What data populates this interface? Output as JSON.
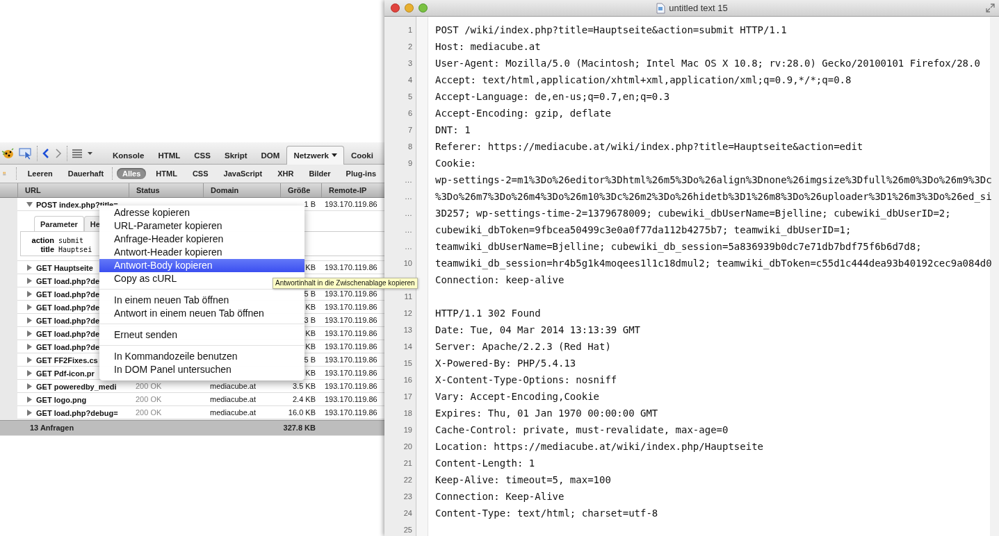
{
  "firebug": {
    "panel_tabs": [
      {
        "label": "Konsole",
        "selected": false
      },
      {
        "label": "HTML",
        "selected": false
      },
      {
        "label": "CSS",
        "selected": false
      },
      {
        "label": "Skript",
        "selected": false
      },
      {
        "label": "DOM",
        "selected": false
      },
      {
        "label": "Netzwerk",
        "selected": true,
        "dropdown": true
      },
      {
        "label": "Cooki",
        "selected": false
      }
    ],
    "actions": [
      "Leeren",
      "Dauerhaft"
    ],
    "filters": [
      {
        "label": "Alles",
        "selected": true
      },
      {
        "label": "HTML",
        "selected": false
      },
      {
        "label": "CSS",
        "selected": false
      },
      {
        "label": "JavaScript",
        "selected": false
      },
      {
        "label": "XHR",
        "selected": false
      },
      {
        "label": "Bilder",
        "selected": false
      },
      {
        "label": "Plug-ins",
        "selected": false
      }
    ],
    "columns": [
      "URL",
      "Status",
      "Domain",
      "Größe",
      "Remote-IP"
    ],
    "requests": [
      {
        "url": "POST index.php?title=",
        "size": "1 B",
        "ip": "193.170.119.86",
        "expanded": true,
        "detail": {
          "tabs": [
            {
              "label": "Parameter",
              "selected": true
            },
            {
              "label": "He",
              "selected": false
            }
          ],
          "params": [
            {
              "name": "action",
              "value": "submit"
            },
            {
              "name": "title",
              "value": "Hauptsei"
            }
          ]
        }
      },
      {
        "url": "GET Hauptseite",
        "size": "KB",
        "ip": "193.170.119.86",
        "expanded": false
      },
      {
        "url": "GET load.php?de",
        "expanded": false
      },
      {
        "url": "GET load.php?de",
        "size": "5 B",
        "ip": "193.170.119.86",
        "expanded": false
      },
      {
        "url": "GET load.php?de",
        "size": "KB",
        "ip": "193.170.119.86",
        "expanded": false
      },
      {
        "url": "GET load.php?de",
        "size": "3 B",
        "ip": "193.170.119.86",
        "expanded": false
      },
      {
        "url": "GET load.php?de",
        "size": "KB",
        "ip": "193.170.119.86",
        "expanded": false
      },
      {
        "url": "GET load.php?de",
        "size": "KB",
        "ip": "193.170.119.86",
        "expanded": false
      },
      {
        "url": "GET FF2Fixes.cs",
        "size": "5 B",
        "ip": "193.170.119.86",
        "expanded": false
      },
      {
        "url": "GET Pdf-icon.pr",
        "size": "KB",
        "ip": "193.170.119.86",
        "expanded": false
      },
      {
        "url": "GET poweredby_medi",
        "status": "200 OK",
        "domain": "mediacube.at",
        "size": "3.5 KB",
        "ip": "193.170.119.86",
        "expanded": false
      },
      {
        "url": "GET logo.png",
        "status": "200 OK",
        "domain": "mediacube.at",
        "size": "2.4 KB",
        "ip": "193.170.119.86",
        "expanded": false
      },
      {
        "url": "GET load.php?debug=",
        "status": "200 OK",
        "domain": "mediacube.at",
        "size": "16.0 KB",
        "ip": "193.170.119.86",
        "expanded": false
      }
    ],
    "footer": {
      "count": "13 Anfragen",
      "total": "327.8 KB"
    }
  },
  "context_menu": [
    [
      {
        "label": "Adresse kopieren",
        "selected": false
      },
      {
        "label": "URL-Parameter kopieren",
        "selected": false
      },
      {
        "label": "Anfrage-Header kopieren",
        "selected": false
      },
      {
        "label": "Antwort-Header kopieren",
        "selected": false
      },
      {
        "label": "Antwort-Body kopieren",
        "selected": true
      },
      {
        "label": "Copy as cURL",
        "selected": false
      }
    ],
    [
      {
        "label": "In einem neuen Tab öffnen",
        "selected": false
      },
      {
        "label": "Antwort in einem neuen Tab öffnen",
        "selected": false
      }
    ],
    [
      {
        "label": "Erneut senden",
        "selected": false
      }
    ],
    [
      {
        "label": "In Kommandozeile benutzen",
        "selected": false
      },
      {
        "label": "In DOM Panel untersuchen",
        "selected": false
      }
    ]
  ],
  "tooltip": "Antwortinhalt in die Zwischenablage kopieren",
  "editor": {
    "title": "untitled text 15",
    "lines": [
      {
        "gutter": "1",
        "text": "POST /wiki/index.php?title=Hauptseite&action=submit HTTP/1.1"
      },
      {
        "gutter": "2",
        "text": "Host: mediacube.at"
      },
      {
        "gutter": "3",
        "text": "User-Agent: Mozilla/5.0 (Macintosh; Intel Mac OS X 10.8; rv:28.0) Gecko/20100101 Firefox/28.0"
      },
      {
        "gutter": "4",
        "text": "Accept: text/html,application/xhtml+xml,application/xml;q=0.9,*/*;q=0.8"
      },
      {
        "gutter": "5",
        "text": "Accept-Language: de,en-us;q=0.7,en;q=0.3"
      },
      {
        "gutter": "6",
        "text": "Accept-Encoding: gzip, deflate"
      },
      {
        "gutter": "7",
        "text": "DNT: 1"
      },
      {
        "gutter": "8",
        "text": "Referer: https://mediacube.at/wiki/index.php?title=Hauptseite&action=edit"
      },
      {
        "gutter": "9",
        "text": "Cookie:"
      },
      {
        "gutter": "…",
        "text": "wp-settings-2=m1%3Do%26editor%3Dhtml%26m5%3Do%26align%3Dnone%26imgsize%3Dfull%26m0%3Do%26m9%3Dc"
      },
      {
        "gutter": "…",
        "text": "%3Do%26m7%3Do%26m4%3Do%26m10%3Dc%26m2%3Do%26hidetb%3D1%26m8%3Do%26uploader%3D1%26m3%3Do%26ed_si"
      },
      {
        "gutter": "…",
        "text": "3D257; wp-settings-time-2=1379678009; cubewiki_dbUserName=Bjelline; cubewiki_dbUserID=2;"
      },
      {
        "gutter": "…",
        "text": "cubewiki_dbToken=9fbcea50499c3e0a0f77da112b4275b7; teamwiki_dbUserID=1;"
      },
      {
        "gutter": "…",
        "text": "teamwiki_dbUserName=Bjelline; cubewiki_db_session=5a836939b0dc7e71db7bdf75f6b6d7d8;"
      },
      {
        "gutter": "10",
        "text": "teamwiki_db_session=hr4b5g1k4moqees1l1c18dmul2; teamwiki_dbToken=c55d1c444dea93b40192cec9a084d0"
      },
      {
        "text": "Connection: keep-alive"
      },
      {
        "gutter": "11"
      },
      {
        "gutter": "12",
        "text": "HTTP/1.1 302 Found"
      },
      {
        "gutter": "13",
        "text": "Date: Tue, 04 Mar 2014 13:13:39 GMT"
      },
      {
        "gutter": "14",
        "text": "Server: Apache/2.2.3 (Red Hat)"
      },
      {
        "gutter": "15",
        "text": "X-Powered-By: PHP/5.4.13"
      },
      {
        "gutter": "16",
        "text": "X-Content-Type-Options: nosniff"
      },
      {
        "gutter": "17",
        "text": "Vary: Accept-Encoding,Cookie"
      },
      {
        "gutter": "18",
        "text": "Expires: Thu, 01 Jan 1970 00:00:00 GMT"
      },
      {
        "gutter": "19",
        "text": "Cache-Control: private, must-revalidate, max-age=0"
      },
      {
        "gutter": "20",
        "text": "Location: https://mediacube.at/wiki/index.php/Hauptseite"
      },
      {
        "gutter": "21",
        "text": "Content-Length: 1"
      },
      {
        "gutter": "22",
        "text": "Keep-Alive: timeout=5, max=100"
      },
      {
        "gutter": "23",
        "text": "Connection: Keep-Alive"
      },
      {
        "gutter": "24",
        "text": "Content-Type: text/html; charset=utf-8"
      },
      {
        "gutter": "25"
      }
    ]
  }
}
